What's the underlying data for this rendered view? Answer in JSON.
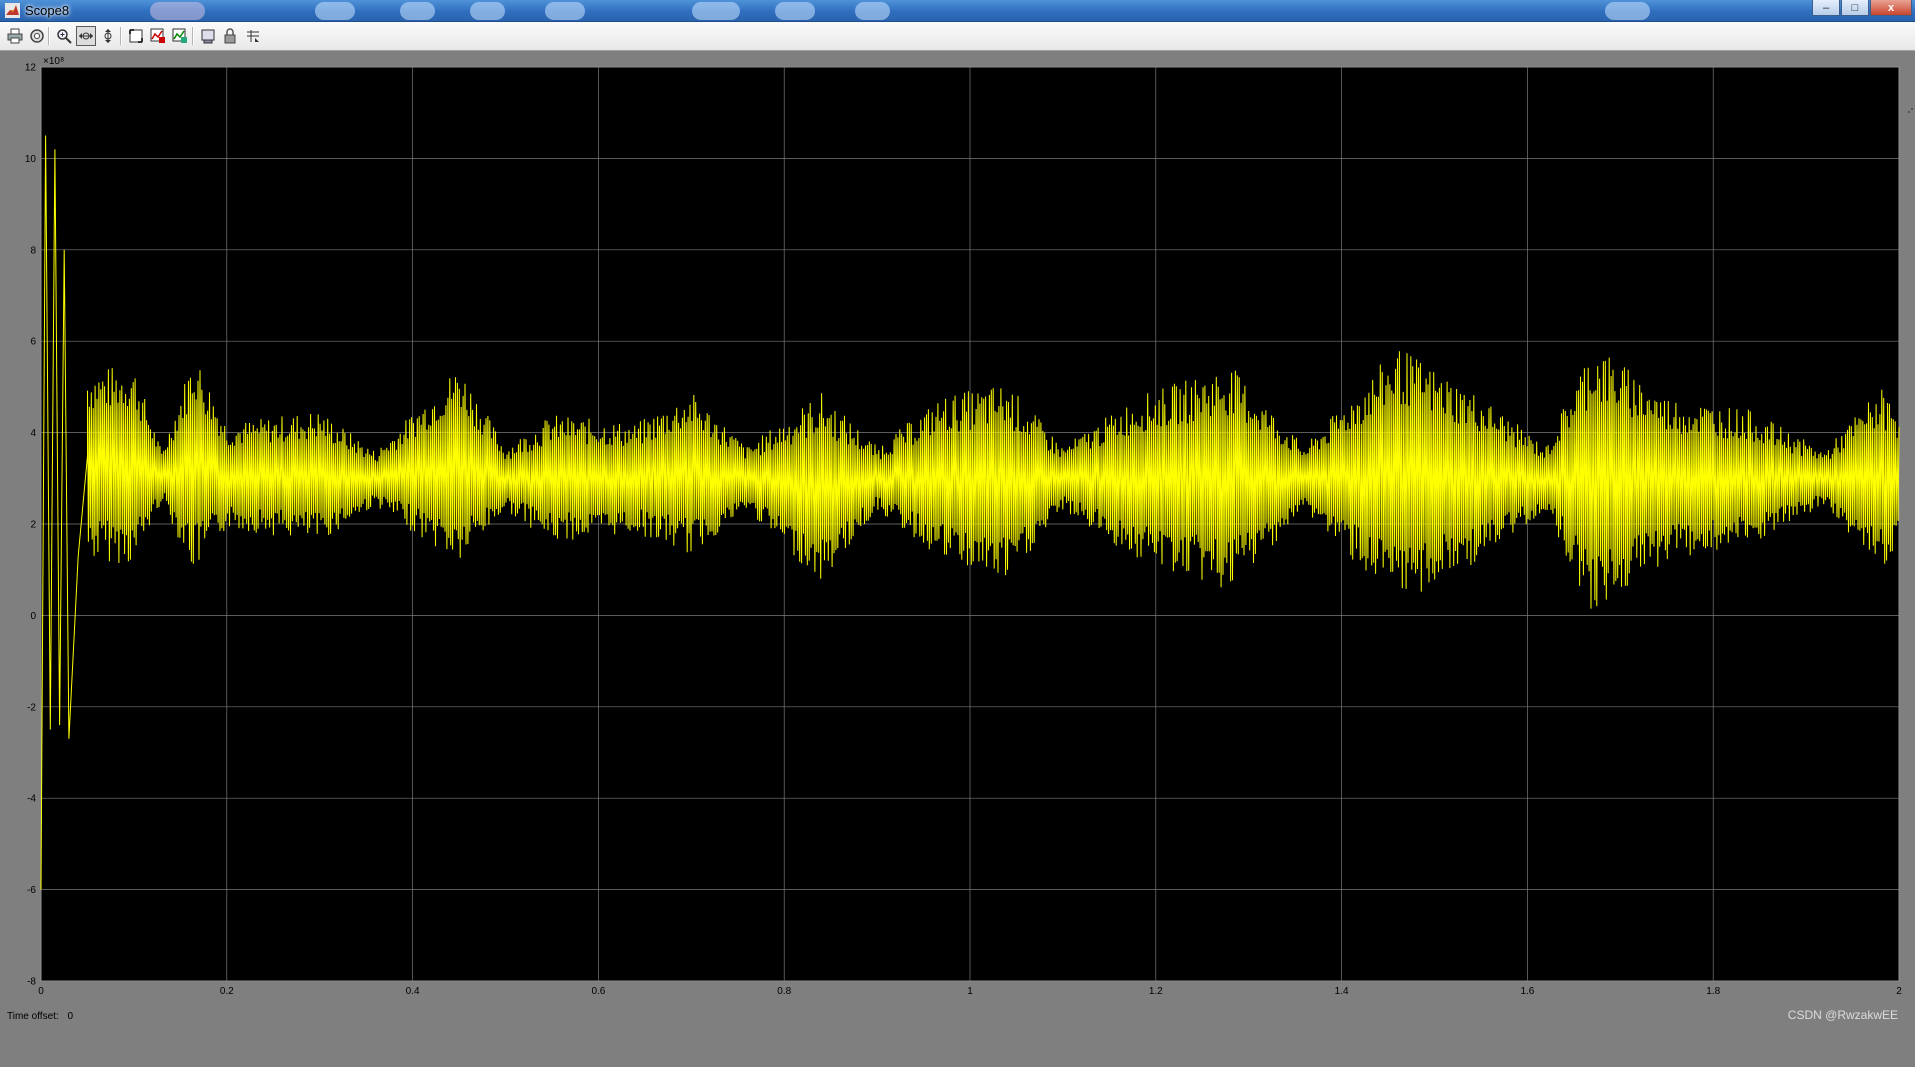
{
  "window": {
    "title": "Scope8",
    "controls": {
      "minimize": "–",
      "maximize": "□",
      "close": "x"
    }
  },
  "toolbar": {
    "buttons": [
      {
        "name": "print-icon"
      },
      {
        "name": "parameters-icon"
      },
      {
        "name": "zoom-icon"
      },
      {
        "name": "zoom-x-icon",
        "active": true
      },
      {
        "name": "zoom-y-icon"
      },
      {
        "name": "autoscale-icon"
      },
      {
        "name": "save-axes-icon"
      },
      {
        "name": "restore-axes-icon"
      },
      {
        "name": "floating-scope-icon"
      },
      {
        "name": "lock-axes-icon"
      },
      {
        "name": "signal-selection-icon"
      }
    ]
  },
  "plot": {
    "background": "#000000",
    "trace_color": "#ffff00",
    "grid": true
  },
  "chart_data": {
    "type": "line",
    "title": "",
    "xlabel": "",
    "ylabel": "",
    "xlim": [
      0,
      2
    ],
    "ylim": [
      -8,
      12
    ],
    "y_exponent": "×10⁸",
    "x_ticks": [
      "0",
      "0.2",
      "0.4",
      "0.6",
      "0.8",
      "1",
      "1.2",
      "1.4",
      "1.6",
      "1.8",
      "2"
    ],
    "y_ticks": [
      "-8",
      "-6",
      "-4",
      "-2",
      "0",
      "2",
      "4",
      "6",
      "8",
      "10",
      "12"
    ],
    "series": [
      {
        "color": "#ffff00",
        "mean": 3.0,
        "startup_transient": [
          {
            "x": 0.0,
            "y": -6.0
          },
          {
            "x": 0.005,
            "y": 10.5
          },
          {
            "x": 0.01,
            "y": -2.5
          },
          {
            "x": 0.015,
            "y": 10.2
          },
          {
            "x": 0.02,
            "y": -2.4
          },
          {
            "x": 0.025,
            "y": 8.0
          },
          {
            "x": 0.03,
            "y": -2.7
          },
          {
            "x": 0.04,
            "y": 1.3
          },
          {
            "x": 0.05,
            "y": 3.5
          }
        ],
        "envelope": [
          {
            "x": 0.05,
            "min": 1.2,
            "max": 5.4
          },
          {
            "x": 0.1,
            "min": 1.1,
            "max": 5.5
          },
          {
            "x": 0.13,
            "min": 2.5,
            "max": 3.6
          },
          {
            "x": 0.165,
            "min": 0.9,
            "max": 5.8
          },
          {
            "x": 0.2,
            "min": 1.9,
            "max": 4.2
          },
          {
            "x": 0.3,
            "min": 1.6,
            "max": 4.5
          },
          {
            "x": 0.36,
            "min": 2.4,
            "max": 3.6
          },
          {
            "x": 0.45,
            "min": 1.1,
            "max": 5.5
          },
          {
            "x": 0.5,
            "min": 2.3,
            "max": 3.7
          },
          {
            "x": 0.55,
            "min": 1.6,
            "max": 4.4
          },
          {
            "x": 0.64,
            "min": 1.8,
            "max": 4.2
          },
          {
            "x": 0.7,
            "min": 1.3,
            "max": 4.9
          },
          {
            "x": 0.76,
            "min": 2.3,
            "max": 3.7
          },
          {
            "x": 0.84,
            "min": 0.7,
            "max": 4.9
          },
          {
            "x": 0.9,
            "min": 2.3,
            "max": 3.7
          },
          {
            "x": 0.97,
            "min": 1.2,
            "max": 4.8
          },
          {
            "x": 1.04,
            "min": 0.7,
            "max": 5.1
          },
          {
            "x": 1.1,
            "min": 2.3,
            "max": 3.7
          },
          {
            "x": 1.18,
            "min": 1.2,
            "max": 4.8
          },
          {
            "x": 1.28,
            "min": 0.5,
            "max": 5.5
          },
          {
            "x": 1.36,
            "min": 2.3,
            "max": 3.7
          },
          {
            "x": 1.46,
            "min": 0.2,
            "max": 5.9
          },
          {
            "x": 1.55,
            "min": 1.2,
            "max": 4.8
          },
          {
            "x": 1.62,
            "min": 2.3,
            "max": 3.7
          },
          {
            "x": 1.67,
            "min": 0.0,
            "max": 6.0
          },
          {
            "x": 1.75,
            "min": 1.2,
            "max": 4.8
          },
          {
            "x": 1.84,
            "min": 1.5,
            "max": 4.5
          },
          {
            "x": 1.92,
            "min": 2.4,
            "max": 3.6
          },
          {
            "x": 1.98,
            "min": 1.0,
            "max": 5.0
          },
          {
            "x": 2.0,
            "min": 1.5,
            "max": 4.5
          }
        ]
      }
    ]
  },
  "status": {
    "time_offset_label": "Time offset:",
    "time_offset_value": "0"
  },
  "watermark": "CSDN @RwzakwEE"
}
